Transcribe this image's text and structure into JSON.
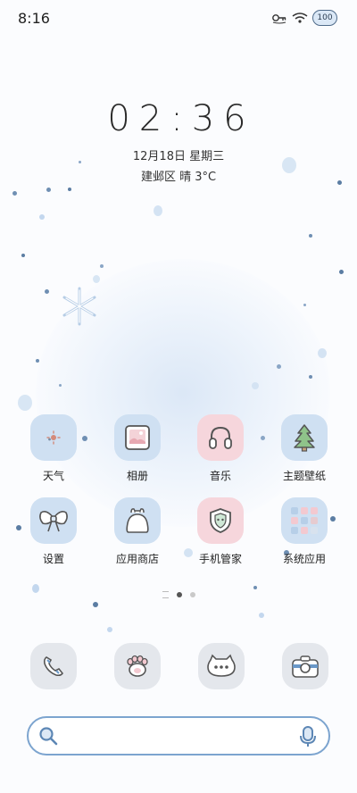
{
  "status_bar": {
    "time": "8:16",
    "battery": "100",
    "icons": [
      "vpn-key-icon",
      "wifi-icon",
      "battery-icon"
    ]
  },
  "clock": {
    "time": "02:36",
    "date": "12月18日 星期三",
    "weather": "建邺区 晴 3°C"
  },
  "apps_row1": [
    {
      "label": "天气",
      "icon": "weather-icon"
    },
    {
      "label": "相册",
      "icon": "photo-album-icon"
    },
    {
      "label": "音乐",
      "icon": "music-headphones-icon"
    },
    {
      "label": "主题壁纸",
      "icon": "theme-tree-icon"
    }
  ],
  "apps_row2": [
    {
      "label": "设置",
      "icon": "settings-bow-icon"
    },
    {
      "label": "应用商店",
      "icon": "app-store-bag-icon"
    },
    {
      "label": "手机管家",
      "icon": "phone-manager-shield-icon"
    },
    {
      "label": "系统应用",
      "icon": "system-apps-folder-icon"
    }
  ],
  "dock": [
    {
      "icon": "phone-icon"
    },
    {
      "icon": "paw-icon"
    },
    {
      "icon": "messages-icon"
    },
    {
      "icon": "camera-icon"
    }
  ],
  "page_indicator": {
    "pages": 2,
    "current": 1
  },
  "search": {
    "placeholder": ""
  },
  "colors": {
    "accent_blue": "#cfe0f2",
    "accent_pink": "#f6d6dc",
    "search_border": "#7ca4cf"
  }
}
